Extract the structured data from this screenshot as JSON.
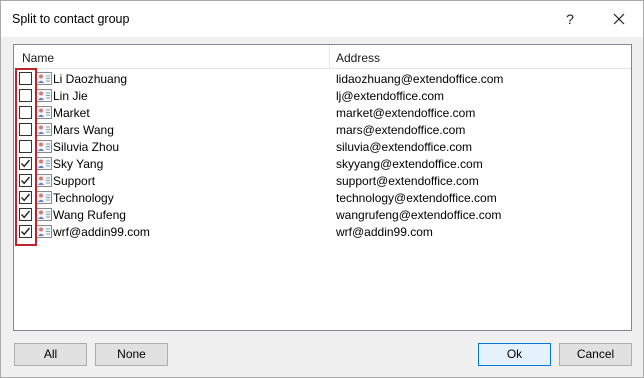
{
  "window": {
    "title": "Split to contact group",
    "help_label": "?"
  },
  "list": {
    "columns": {
      "name": "Name",
      "address": "Address"
    },
    "rows": [
      {
        "name": "Li Daozhuang",
        "address": "lidaozhuang@extendoffice.com",
        "checked": false
      },
      {
        "name": "Lin Jie",
        "address": "lj@extendoffice.com",
        "checked": false
      },
      {
        "name": "Market",
        "address": "market@extendoffice.com",
        "checked": false
      },
      {
        "name": "Mars Wang",
        "address": "mars@extendoffice.com",
        "checked": false
      },
      {
        "name": "Siluvia Zhou",
        "address": "siluvia@extendoffice.com",
        "checked": false
      },
      {
        "name": "Sky Yang",
        "address": "skyyang@extendoffice.com",
        "checked": true
      },
      {
        "name": "Support",
        "address": "support@extendoffice.com",
        "checked": true
      },
      {
        "name": "Technology",
        "address": "technology@extendoffice.com",
        "checked": true
      },
      {
        "name": "Wang Rufeng",
        "address": "wangrufeng@extendoffice.com",
        "checked": true
      },
      {
        "name": "wrf@addin99.com",
        "address": "wrf@addin99.com",
        "checked": true
      }
    ]
  },
  "buttons": {
    "all": "All",
    "none": "None",
    "ok": "Ok",
    "cancel": "Cancel"
  },
  "colors": {
    "highlight": "#c0232c",
    "ok_border": "#0078d7"
  }
}
